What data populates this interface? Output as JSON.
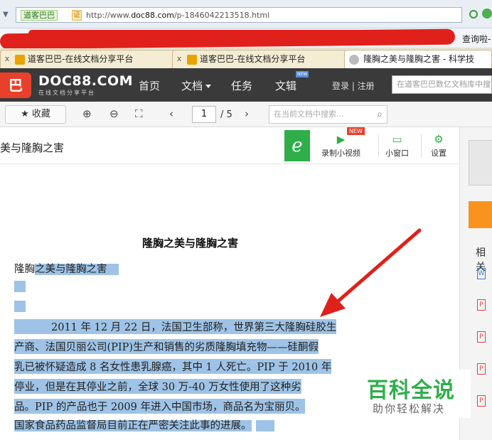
{
  "browser": {
    "site_name": "道客巴巴",
    "cert_label": "证",
    "url_prefix": "http://www.",
    "url_domain": "doc88.com",
    "url_path": "/p-1846042213518.html",
    "bookmark_right": "查询啦-"
  },
  "tabs": [
    {
      "label": "道客巴巴-在线文档分享平台",
      "close": "x"
    },
    {
      "label": "道客巴巴-在线文档分享平台",
      "close": "x"
    },
    {
      "label": "隆胸之美与隆胸之害 - 科学技",
      "close": ""
    }
  ],
  "site": {
    "logo_text": "DOC88.COM",
    "logo_sub": "在线文档分享平台",
    "nav": [
      "首页",
      "文档",
      "任务",
      "文辑"
    ],
    "nav_new_badge": "NEW",
    "login": "登录 | 注册",
    "search_placeholder": "在道客巴巴数亿文档库中搜"
  },
  "toolbar": {
    "favorite": "★ 收藏",
    "page_current": "1",
    "page_total": "/ 5",
    "search_placeholder": "在当前文档中搜索..."
  },
  "doc_header": {
    "title": "美与隆胸之害",
    "new_badge": "NEW",
    "tools": [
      "录制小视频",
      "小窗口",
      "设置"
    ]
  },
  "sidebar": {
    "related": "相关"
  },
  "document": {
    "title": "隆胸之美与隆胸之害",
    "line1_plain": "隆胸",
    "line1_hl": "之美与隆胸之害",
    "p1": "2011 年 12 月 22 日，法国卫生部称，世界第三大隆胸硅胶生",
    "p2": "产商、法国贝丽公司(PIP)生产和销售的劣质隆胸填充物——硅酮假",
    "p3": "乳已被怀疑造成 8 名女性患乳腺癌，其中 1 人死亡。PIP 于 2010 年",
    "p4": "停业，但是在其停业之前，全球 30 万-40 万女性使用了这种劣",
    "p5": "品。PIP 的产品也于 2009 年进入中国市场，商品名为宝丽贝。",
    "p6": "国家食品药品监督局目前正在严密关注此事的进展。"
  },
  "watermark": {
    "big": "百科全说",
    "small": "助你轻松解决"
  },
  "colors": {
    "highlight": "#9ec3e6",
    "annotation_red": "#e0201a",
    "brand_red": "#e8402a",
    "brand_green": "#2fae4a"
  }
}
